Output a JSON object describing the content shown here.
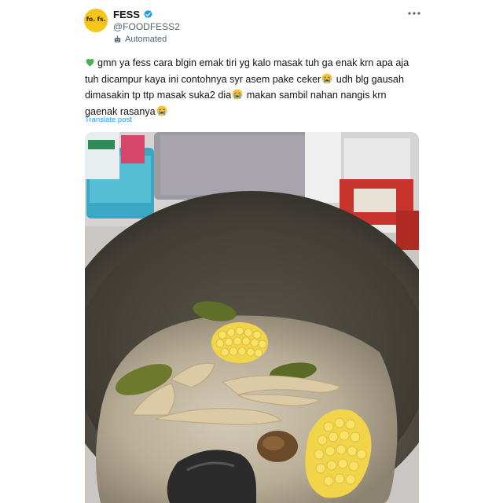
{
  "account": {
    "avatar_text": "fo. fs.",
    "display_name": "FESS",
    "handle": "@FOODFESS2",
    "automated_label": "Automated"
  },
  "tweet": {
    "line1": "gmn ya fess cara blgin emak tiri yg kalo masak tuh ga enak krn apa aja tuh dicampur kaya ini contohnya syr asem pake ceker",
    "line2": " udh blg gausah dimasakin tp ttp masak suka2 dia",
    "line3": " makan sambil nahan nangis krn gaenak rasanya",
    "translate_label": "Translate post"
  },
  "icons": {
    "more": "more-options-icon",
    "verified": "verified-badge-icon",
    "automated": "bot-icon",
    "leading_emoji": "green-heart-emoji",
    "crying_emoji": "loudly-crying-face-emoji"
  },
  "colors": {
    "avatar_bg": "#f5c518",
    "verified": "#1d9bf0",
    "link": "#1d9bf0",
    "heart": "#4caf50",
    "text": "#0f1419",
    "muted": "#536471"
  },
  "photo": {
    "subject": "pot of sour soup with chicken feet and corn"
  }
}
